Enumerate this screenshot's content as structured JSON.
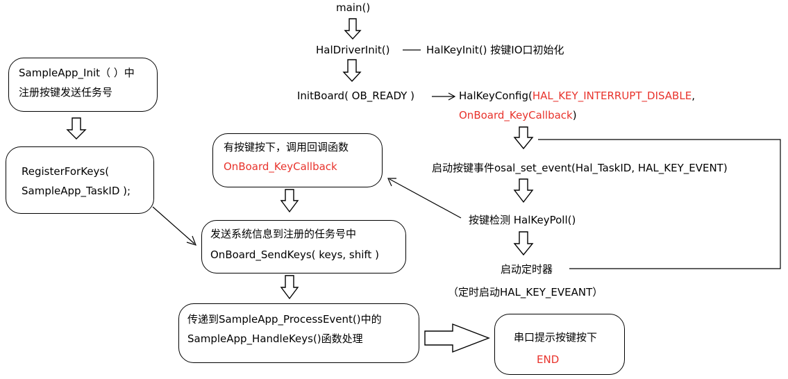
{
  "colors": {
    "highlight": "#e8332c",
    "line": "#000000"
  },
  "main_flow": {
    "main": "main()",
    "hal_driver_init": "HalDriverInit()",
    "hal_key_init": "HalKeyInit()  按键IO口初始化",
    "init_board": "InitBoard( OB_READY )",
    "hal_key_config_prefix": "HalKeyConfig(",
    "hal_key_config_arg1": "HAL_KEY_INTERRUPT_DISABLE",
    "hal_key_config_comma": ",",
    "hal_key_config_arg2": "OnBoard_KeyCallback",
    "hal_key_config_close": ")",
    "start_event": "启动按键事件osal_set_event(Hal_TaskID, HAL_KEY_EVENT)",
    "key_poll": "按键检测  HalKeyPoll()",
    "start_timer": "启动定时器",
    "timer_note": "（定时启动HAL_KEY_EVEANT）"
  },
  "boxes": {
    "sample_init": {
      "line1": "SampleApp_Init（ ）中",
      "line2": "注册按键发送任务号"
    },
    "register": {
      "line1": "RegisterForKeys(",
      "line2": "SampleApp_TaskID );"
    },
    "callback": {
      "line1": "有按键按下，调用回调函数",
      "line2": "OnBoard_KeyCallback"
    },
    "send_keys": {
      "line1": "发送系统信息到注册的任务号中",
      "line2": "OnBoard_SendKeys( keys, shift )"
    },
    "process": {
      "line1": "传递到SampleApp_ProcessEvent()中的",
      "line2": "SampleApp_HandleKeys()函数处理"
    },
    "end": {
      "line1": "串口提示按键按下",
      "line2": "END"
    }
  }
}
